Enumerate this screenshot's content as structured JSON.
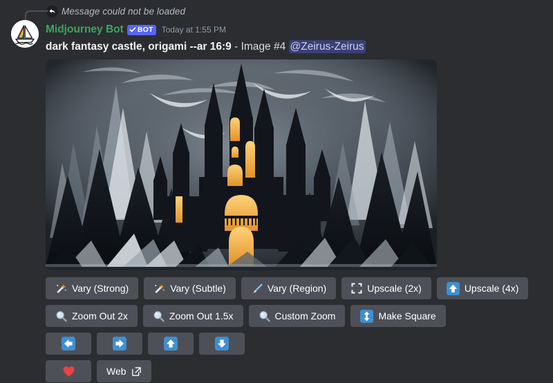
{
  "reply": {
    "icon": "reply-arrow-icon",
    "text": "Message could not be loaded"
  },
  "author": {
    "avatar_icon": "midjourney-sailboat-avatar",
    "name": "Midjourney Bot",
    "bot_badge_label": "BOT",
    "bot_badge_check_icon": "verified-check-icon",
    "timestamp": "Today at 1:55 PM"
  },
  "message": {
    "prompt": "dark fantasy castle, origami --ar 16:9",
    "suffix": " - Image #4 ",
    "mention": "@Zeirus-Zeirus"
  },
  "attachment": {
    "alt": "dark fantasy origami castle at night with glowing amber windows surrounded by paper spires"
  },
  "action_rows": [
    {
      "buttons": [
        {
          "label": "Vary (Strong)",
          "icon": "magic-wand-icon",
          "name": "vary-strong-button"
        },
        {
          "label": "Vary (Subtle)",
          "icon": "magic-wand-icon",
          "name": "vary-subtle-button"
        },
        {
          "label": "Vary (Region)",
          "icon": "paintbrush-icon",
          "name": "vary-region-button"
        },
        {
          "label": "Upscale (2x)",
          "icon": "expand-corners-icon",
          "name": "upscale-2x-button"
        },
        {
          "label": "Upscale (4x)",
          "icon": "arrow-up-square-icon",
          "name": "upscale-4x-button"
        }
      ]
    },
    {
      "buttons": [
        {
          "label": "Zoom Out 2x",
          "icon": "magnifier-icon",
          "name": "zoom-out-2x-button"
        },
        {
          "label": "Zoom Out 1.5x",
          "icon": "magnifier-icon",
          "name": "zoom-out-1-5x-button"
        },
        {
          "label": "Custom Zoom",
          "icon": "magnifier-icon",
          "name": "custom-zoom-button"
        },
        {
          "label": "Make Square",
          "icon": "arrow-up-down-square-icon",
          "name": "make-square-button"
        }
      ]
    },
    {
      "buttons": [
        {
          "label": "",
          "icon": "arrow-left-square-icon",
          "name": "pan-left-button"
        },
        {
          "label": "",
          "icon": "arrow-right-square-icon",
          "name": "pan-right-button"
        },
        {
          "label": "",
          "icon": "arrow-up-square-icon",
          "name": "pan-up-button"
        },
        {
          "label": "",
          "icon": "arrow-down-square-icon",
          "name": "pan-down-button"
        }
      ]
    },
    {
      "buttons": [
        {
          "label": "",
          "icon": "heart-icon",
          "name": "favorite-button"
        },
        {
          "label": "Web",
          "icon": "external-link-icon",
          "name": "web-button"
        }
      ]
    }
  ],
  "colors": {
    "background": "#2b2d31",
    "button": "#4e5058",
    "blurple": "#5865f2",
    "bot_name_green": "#3ba55c",
    "accent_blue": "#3f8fd0",
    "heart_red": "#ed4245",
    "muted_text": "#949ba4"
  }
}
